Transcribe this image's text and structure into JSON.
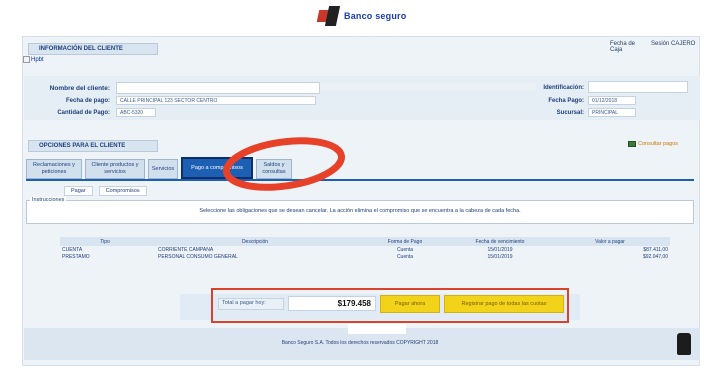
{
  "header": {
    "logo_text": "Banco seguro",
    "tab_label": "INFORMACIÓN DEL CLIENTE",
    "broken_image_alt": "Hpbt",
    "top_right_left": "Fecha de Caja",
    "top_right_right": "Sesión CAJERO"
  },
  "client_info": {
    "name_label": "Nombre del cliente:",
    "name_value": "",
    "name_mid_value": "",
    "address_label": "Fecha de pago:",
    "address_value": "CALLE PRINCIPAL 123 SECTOR CENTRO",
    "account_label": "Cantidad de Pago:",
    "account_value": "ABC-5320",
    "id_label": "Identificación:",
    "id_value": "",
    "phone_label": "Fecha Pago:",
    "phone_value": "01/12/2018",
    "agency_label": "Sucursal:",
    "agency_value": "PRINCIPAL"
  },
  "section": {
    "title": "OPCIONES PARA EL CLIENTE",
    "right_link": "Consultar pagos"
  },
  "tabs": [
    {
      "label": "Reclamaciones y peticiones"
    },
    {
      "label": "Cliente productos y servicios"
    },
    {
      "label": "Servicios"
    },
    {
      "label": "Pago a compromisos"
    },
    {
      "label": "Saldos y consultas"
    }
  ],
  "subtabs": [
    {
      "label": "Pagar"
    },
    {
      "label": "Compromisos"
    }
  ],
  "instructions": {
    "title": "Instrucciones",
    "text": "Seleccione las obligaciones que se desean cancelar. La acción elimina el compromiso que se encuentra a la cabeza de cada fecha."
  },
  "table": {
    "headers": [
      "Tipo",
      "Descripción",
      "Forma de Pago",
      "Fecha de vencimiento",
      "Valor a pagar"
    ],
    "rows": [
      [
        "CUENTA",
        "CORRIENTE CAMPAÑA",
        "Cuenta",
        "15/01/2019",
        "$87.411,00"
      ],
      [
        "PRÉSTAMO",
        "PERSONAL CONSUMO GENERAL",
        "Cuenta",
        "15/01/2019",
        "$92.047,00"
      ]
    ]
  },
  "payment": {
    "total_label": "Total a pagar hoy:",
    "total_value": "$179.458",
    "pay_button": "Pagar ahora",
    "pay_all_button": "Registrar pago de todas las cuotas"
  },
  "footer": {
    "text": "Banco Seguro S.A. Todos los derechos reservados COPYRIGHT 2018"
  },
  "colors": {
    "accent_red": "#d9432e",
    "tab_active": "#1d5fb3",
    "button_yellow": "#f3d21a"
  }
}
